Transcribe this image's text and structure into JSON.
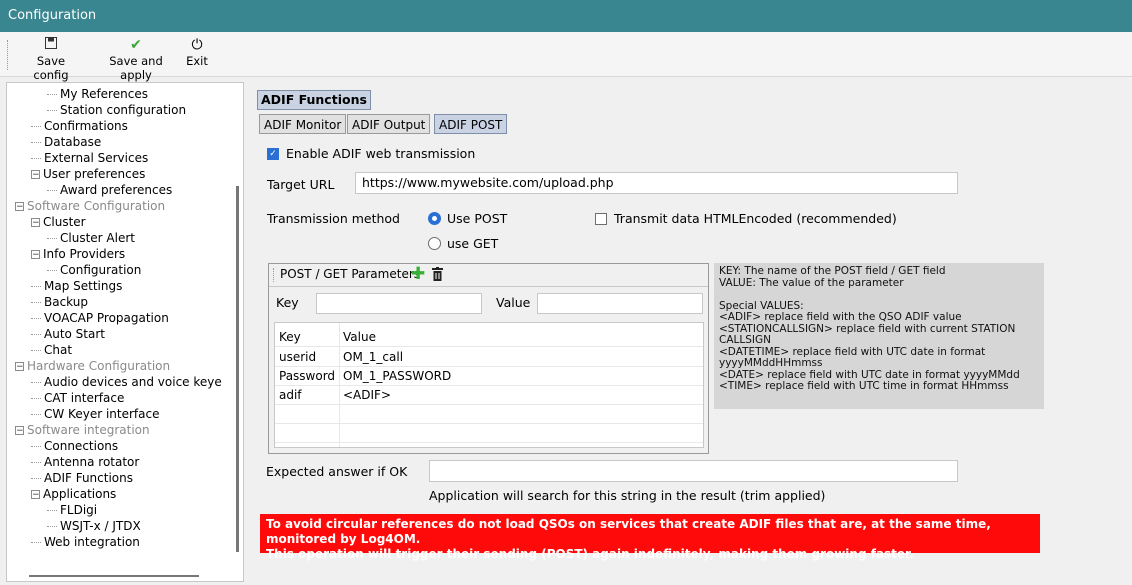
{
  "window": {
    "title": "Configuration"
  },
  "toolbar": {
    "buttons": [
      {
        "label": "Save config",
        "icon": "floppy-disk-icon"
      },
      {
        "label": "Save and apply",
        "icon": "green-check-icon"
      },
      {
        "label": "Exit",
        "icon": "power-icon"
      }
    ]
  },
  "tree": {
    "items": [
      {
        "label": "My References",
        "kind": "leaf"
      },
      {
        "label": "Station configuration",
        "kind": "leaf"
      },
      {
        "label": "Confirmations",
        "kind": "leaf"
      },
      {
        "label": "Database",
        "kind": "leaf"
      },
      {
        "label": "External Services",
        "kind": "leaf"
      },
      {
        "label": "User preferences",
        "kind": "node"
      },
      {
        "label": "Award preferences",
        "kind": "leaf"
      },
      {
        "label": "Software Configuration",
        "kind": "category"
      },
      {
        "label": "Cluster",
        "kind": "node"
      },
      {
        "label": "Cluster Alert",
        "kind": "leaf"
      },
      {
        "label": "Info Providers",
        "kind": "node"
      },
      {
        "label": "Configuration",
        "kind": "leaf"
      },
      {
        "label": "Map Settings",
        "kind": "leaf"
      },
      {
        "label": "Backup",
        "kind": "leaf"
      },
      {
        "label": "VOACAP Propagation",
        "kind": "leaf"
      },
      {
        "label": "Auto Start",
        "kind": "leaf"
      },
      {
        "label": "Chat",
        "kind": "leaf"
      },
      {
        "label": "Hardware Configuration",
        "kind": "category"
      },
      {
        "label": "Audio devices and voice keye",
        "kind": "leaf"
      },
      {
        "label": "CAT interface",
        "kind": "leaf"
      },
      {
        "label": "CW Keyer interface",
        "kind": "leaf"
      },
      {
        "label": "Software integration",
        "kind": "category"
      },
      {
        "label": "Connections",
        "kind": "leaf"
      },
      {
        "label": "Antenna rotator",
        "kind": "leaf"
      },
      {
        "label": "ADIF Functions",
        "kind": "leaf"
      },
      {
        "label": "Applications",
        "kind": "node"
      },
      {
        "label": "FLDigi",
        "kind": "leaf"
      },
      {
        "label": "WSJT-x / JTDX",
        "kind": "leaf"
      },
      {
        "label": "Web integration",
        "kind": "leaf"
      }
    ]
  },
  "main": {
    "section_title": "ADIF Functions",
    "tabs": [
      "ADIF Monitor",
      "ADIF Output",
      "ADIF POST"
    ],
    "active_tab": "ADIF POST",
    "enable_label": "Enable ADIF web transmission",
    "enable_checked": true,
    "target_url_label": "Target URL",
    "target_url_value": "https://www.mywebsite.com/upload.php",
    "method_label": "Transmission method",
    "use_post_label": "Use POST",
    "use_get_label": "use GET",
    "selected_method": "Use POST",
    "encode_label": "Transmit data HTMLEncoded (recommended)",
    "encode_checked": false,
    "params": {
      "title": "POST / GET Parameters",
      "key_label": "Key",
      "value_label": "Value",
      "key_input": "",
      "value_input": "",
      "columns": [
        "Key",
        "Value"
      ],
      "rows": [
        [
          "userid",
          "OM_1_call"
        ],
        [
          "Password",
          "OM_1_PASSWORD"
        ],
        [
          "adif",
          "<ADIF>"
        ]
      ]
    },
    "info_lines": [
      "KEY: The name of the POST field / GET field",
      "VALUE: The value of the parameter",
      "",
      "Special VALUES:",
      "<ADIF> replace field with the QSO ADIF value",
      "<STATIONCALLSIGN> replace field with current STATION CALLSIGN",
      "<DATETIME> replace field with UTC date in format yyyyMMddHHmmss",
      "<DATE> replace field with UTC date in format yyyyMMdd",
      "<TIME> replace field with UTC time in format HHmmss"
    ],
    "expected_label": "Expected answer if OK",
    "expected_value": "",
    "expected_hint": "Application will search for this string in the result (trim applied)",
    "warning_lines": [
      "To avoid circular references do not load QSOs on services that create ADIF files that are, at the same time, monitored by Log4OM.",
      "This operation will trigger their sending (POST) again indefinitely, making them growing faster."
    ],
    "colors": {
      "warning_bg": "#ff0a0a",
      "accent": "#2a6fd3",
      "titlebar": "#3a8690"
    }
  }
}
